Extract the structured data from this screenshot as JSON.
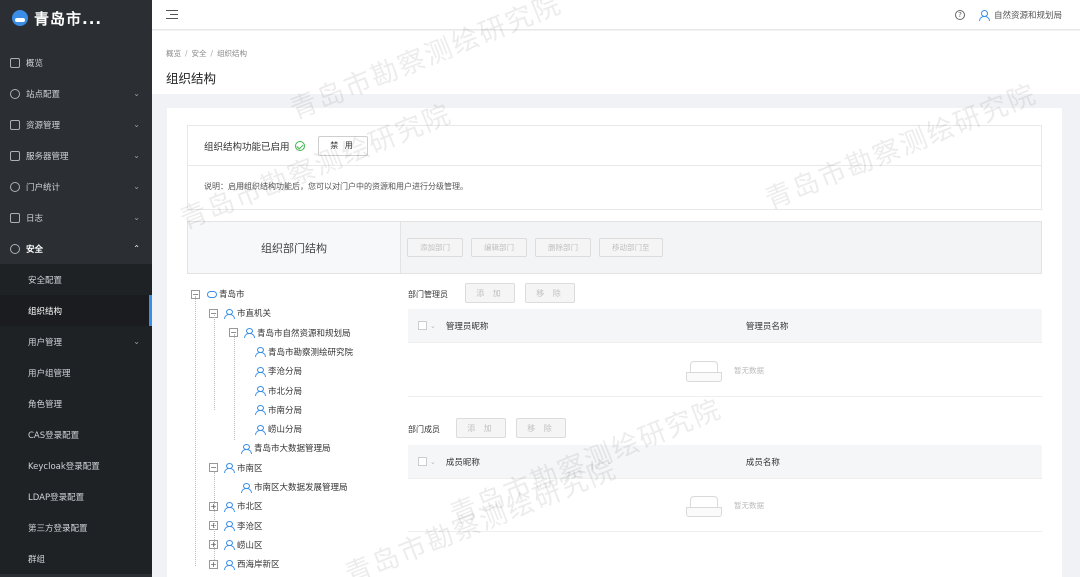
{
  "brand": {
    "title": "青岛市..."
  },
  "sidebar": {
    "items": [
      {
        "label": "概览",
        "icon": "home-icon",
        "has_chevron": false
      },
      {
        "label": "站点配置",
        "icon": "gear-icon",
        "has_chevron": true
      },
      {
        "label": "资源管理",
        "icon": "table-icon",
        "has_chevron": true
      },
      {
        "label": "服务器管理",
        "icon": "server-icon",
        "has_chevron": true
      },
      {
        "label": "门户统计",
        "icon": "chart-icon",
        "has_chevron": true
      },
      {
        "label": "日志",
        "icon": "log-icon",
        "has_chevron": true
      },
      {
        "label": "安全",
        "icon": "shield-icon",
        "has_chevron": true,
        "open": true
      }
    ],
    "subitems": [
      {
        "label": "安全配置"
      },
      {
        "label": "组织结构",
        "active": true
      },
      {
        "label": "用户管理",
        "has_chevron": true
      },
      {
        "label": "用户组管理"
      },
      {
        "label": "角色管理"
      },
      {
        "label": "CAS登录配置"
      },
      {
        "label": "Keycloak登录配置"
      },
      {
        "label": "LDAP登录配置"
      },
      {
        "label": "第三方登录配置"
      },
      {
        "label": "群组"
      }
    ],
    "chevron_down": "⌄",
    "chevron_up": "⌃"
  },
  "header": {
    "help_glyph": "?",
    "user_name": "自然资源和规划局"
  },
  "breadcrumb": [
    "概览",
    "安全",
    "组织结构"
  ],
  "breadcrumb_sep": "/",
  "page_title": "组织结构",
  "status": {
    "text": "组织结构功能已启用",
    "disable_button": "禁 用",
    "description": "说明：启用组织结构功能后，您可以对门户中的资源和用户进行分级管理。"
  },
  "org": {
    "title": "组织部门结构",
    "actions": [
      "添加部门",
      "编辑部门",
      "删除部门",
      "移动部门至"
    ]
  },
  "tree": [
    {
      "label": "青岛市",
      "level": 0,
      "toggle": "−",
      "icon": "cloud"
    },
    {
      "label": "市直机关",
      "level": 1,
      "toggle": "−"
    },
    {
      "label": "青岛市自然资源和规划局",
      "level": 2,
      "toggle": "−"
    },
    {
      "label": "青岛市勘察测绘研究院",
      "level": 3
    },
    {
      "label": "李沧分局",
      "level": 3
    },
    {
      "label": "市北分局",
      "level": 3
    },
    {
      "label": "市南分局",
      "level": 3
    },
    {
      "label": "崂山分局",
      "level": 3
    },
    {
      "label": "青岛市大数据管理局",
      "level": 2
    },
    {
      "label": "市南区",
      "level": 1,
      "toggle": "−"
    },
    {
      "label": "市南区大数据发展管理局",
      "level": 2
    },
    {
      "label": "市北区",
      "level": 1,
      "toggle": "+"
    },
    {
      "label": "李沧区",
      "level": 1,
      "toggle": "+"
    },
    {
      "label": "崂山区",
      "level": 1,
      "toggle": "+"
    },
    {
      "label": "西海岸新区",
      "level": 1,
      "toggle": "+"
    }
  ],
  "admins": {
    "label": "部门管理员",
    "add": "添 加",
    "remove": "移 除",
    "col_nick": "管理员昵称",
    "col_name": "管理员名称",
    "empty": "暂无数据"
  },
  "members": {
    "label": "部门成员",
    "add": "添 加",
    "remove": "移 除",
    "col_nick": "成员昵称",
    "col_name": "成员名称",
    "empty": "暂无数据"
  },
  "watermark": "青岛市勘察测绘研究院",
  "colors": {
    "sidebar_bg": "#2b2f33",
    "accent": "#3a8ee6",
    "success": "#3bb34a"
  }
}
